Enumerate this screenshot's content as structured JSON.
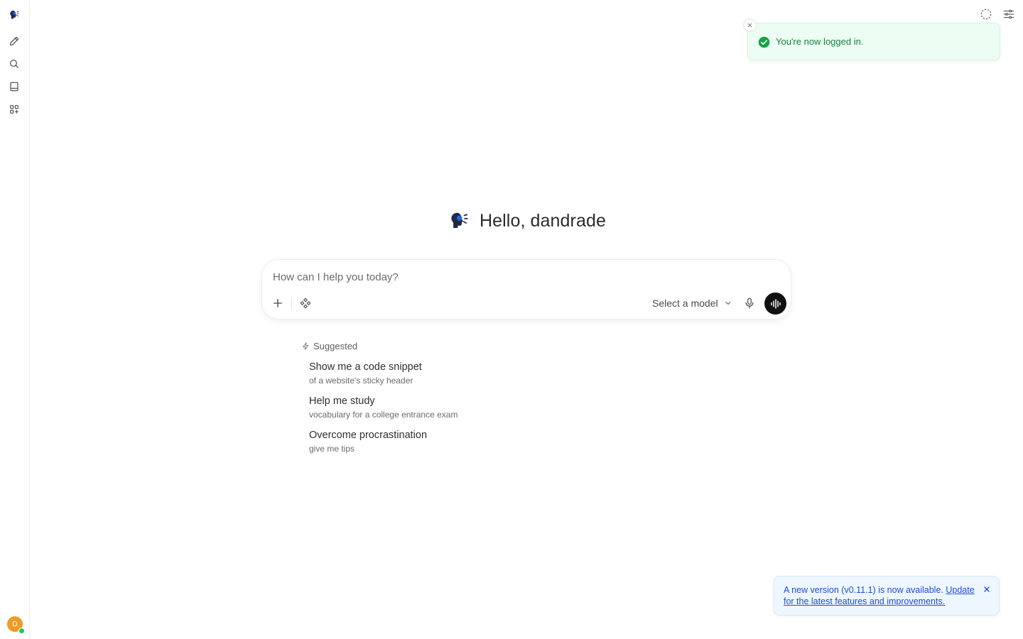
{
  "greeting": {
    "text": "Hello, dandrade"
  },
  "chat_input": {
    "placeholder": "How can I help you today?",
    "model_select_label": "Select a model"
  },
  "suggestions": {
    "header": "Suggested",
    "items": [
      {
        "title": "Show me a code snippet",
        "subtitle": "of a website's sticky header"
      },
      {
        "title": "Help me study",
        "subtitle": "vocabulary for a college entrance exam"
      },
      {
        "title": "Overcome procrastination",
        "subtitle": "give me tips"
      }
    ]
  },
  "toast": {
    "message": "You're now logged in."
  },
  "update_banner": {
    "text": "A new version (v0.11.1) is now available.",
    "link_text": "Update for the latest features and improvements."
  },
  "user": {
    "initial": "D",
    "status": "online"
  },
  "colors": {
    "accent_dark": "#111111",
    "success": "#16803d",
    "info": "#1d4ed8",
    "avatar": "#ee9b2a"
  },
  "icons": {
    "sidebar": [
      "app-logo-icon",
      "new-chat-icon",
      "search-icon",
      "notes-icon",
      "workspace-icon"
    ],
    "top_right": [
      "temporary-chat-icon",
      "controls-icon"
    ]
  }
}
